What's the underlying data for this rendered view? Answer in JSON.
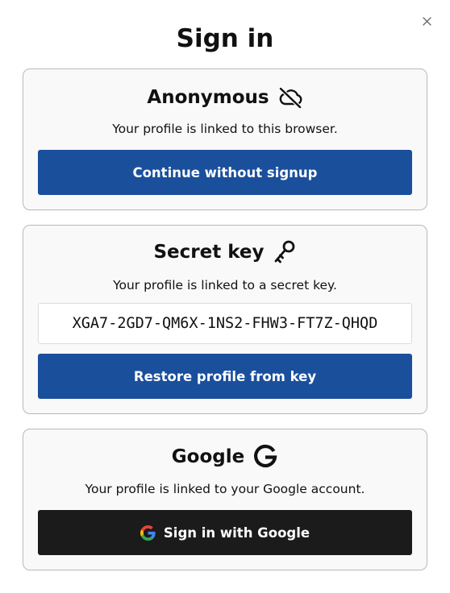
{
  "dialog": {
    "title": "Sign in",
    "close_icon": "close-icon"
  },
  "anonymous": {
    "heading": "Anonymous",
    "icon": "cloud-off-icon",
    "description": "Your profile is linked to this browser.",
    "button_label": "Continue without signup",
    "button_color": "#1a4f9c"
  },
  "secret_key": {
    "heading": "Secret key",
    "icon": "key-icon",
    "description": "Your profile is linked to a secret key.",
    "key_value": "XGA7-2GD7-QM6X-1NS2-FHW3-FT7Z-QHQD",
    "button_label": "Restore profile from key",
    "button_color": "#1a4f9c"
  },
  "google": {
    "heading": "Google",
    "icon": "google-g-icon",
    "description": "Your profile is linked to your Google account.",
    "button_label": "Sign in with Google",
    "button_color": "#1b1b1b"
  }
}
